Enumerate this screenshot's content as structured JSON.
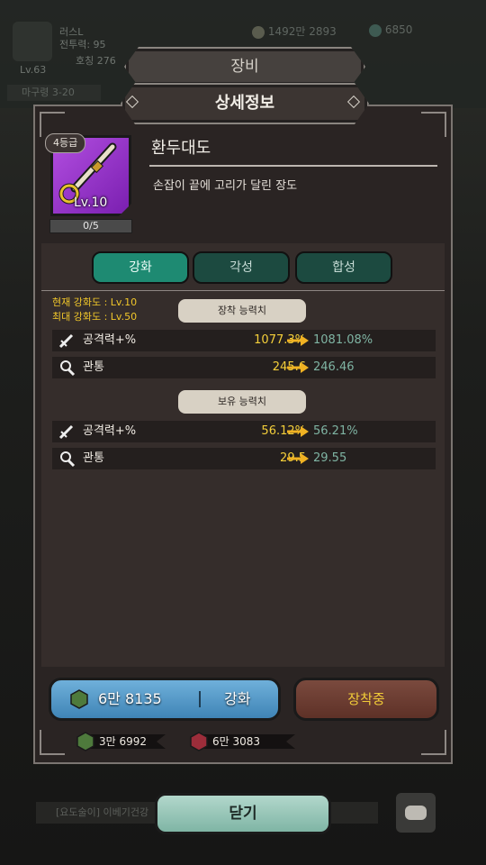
{
  "background": {
    "player_name": "러스L",
    "player_power": "전투력: 95",
    "player_level": "Lv.63",
    "player_sub": "호칭 276",
    "gold": "1492만 2893",
    "gems": "6850",
    "stage": "마구령 3-20",
    "chat_text": "[요도술이] 이베기건강"
  },
  "header": {
    "title": "장비",
    "subtitle": "상세정보"
  },
  "item": {
    "grade": "4등급",
    "name": "환두대도",
    "description": "손잡이 끝에 고리가 달린 장도",
    "level": "Lv.10",
    "progress_text": "0/5",
    "progress_fraction": 0
  },
  "tabs": [
    {
      "label": "강화",
      "active": true
    },
    {
      "label": "각성",
      "active": false
    },
    {
      "label": "합성",
      "active": false
    }
  ],
  "enhance": {
    "current": "현재 강화도 : Lv.10",
    "max": "최대 강화도 : Lv.50"
  },
  "equip_stats": {
    "label": "장착 능력치",
    "rows": [
      {
        "icon": "sword-icon",
        "name": "공격력+%",
        "current": "1077.3%",
        "next": "1081.08%"
      },
      {
        "icon": "pierce-icon",
        "name": "관통",
        "current": "245.6",
        "next": "246.46"
      }
    ]
  },
  "own_stats": {
    "label": "보유 능력치",
    "rows": [
      {
        "icon": "sword-icon",
        "name": "공격력+%",
        "current": "56.12%",
        "next": "56.21%"
      },
      {
        "icon": "pierce-icon",
        "name": "관통",
        "current": "29.5",
        "next": "29.55"
      }
    ]
  },
  "actions": {
    "enhance_cost": "6만 8135",
    "enhance_label": "강화",
    "equip_label": "장착중",
    "close_label": "닫기"
  },
  "resources": [
    {
      "icon": "green-ore-icon",
      "value": "3만 6992"
    },
    {
      "icon": "red-ore-icon",
      "value": "6만 3083"
    }
  ],
  "colors": {
    "tab_active": "#1e8a72",
    "tab_inactive": "#1c4a40",
    "current_value": "#f4cf3a",
    "next_value": "#7fb4a3",
    "enhance_button": "#4f94c4",
    "equip_button": "#6b3c31",
    "item_frame": "#9b38cf"
  }
}
